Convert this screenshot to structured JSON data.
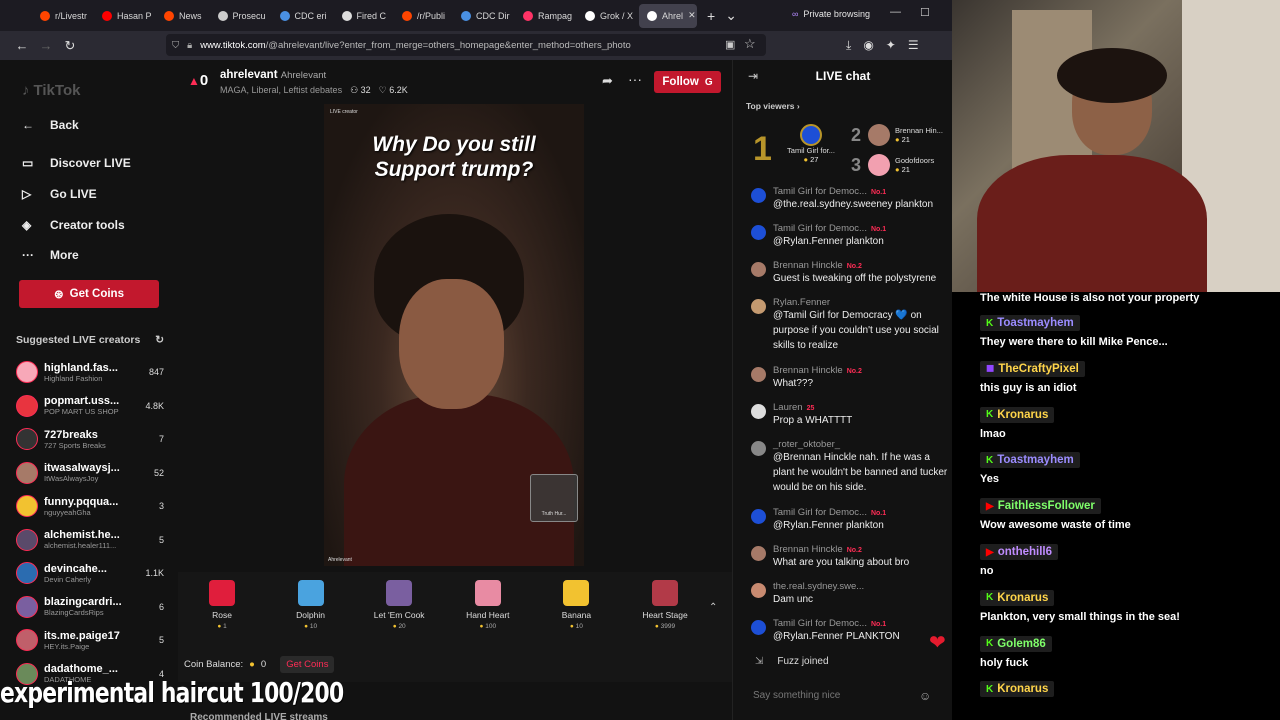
{
  "browser": {
    "tabs": [
      {
        "title": "r/Livestr",
        "color": "#ff4500"
      },
      {
        "title": "Hasan P",
        "color": "#ff0000"
      },
      {
        "title": "News",
        "color": "#ff4500"
      },
      {
        "title": "Prosecu",
        "color": "#cccccc"
      },
      {
        "title": "CDC eri",
        "color": "#4a90e2"
      },
      {
        "title": "Fired C",
        "color": "#dddddd"
      },
      {
        "title": "/r/Publi",
        "color": "#ff4500"
      },
      {
        "title": "CDC Dir",
        "color": "#4a90e2"
      },
      {
        "title": "Rampag",
        "color": "#ff3366"
      },
      {
        "title": "Grok / X",
        "color": "#ffffff"
      },
      {
        "title": "Ahrel",
        "color": "#ffffff"
      }
    ],
    "private_label": "Private browsing",
    "url_host": "www.tiktok.com",
    "url_path": "/@ahrelevant/live?enter_from_merge=others_homepage&enter_method=others_photo"
  },
  "sidebar": {
    "logo": "TikTok",
    "back": "Back",
    "discover": "Discover LIVE",
    "golive": "Go LIVE",
    "creator_tools": "Creator tools",
    "more": "More",
    "get_coins": "Get Coins",
    "suggested_title": "Suggested LIVE creators",
    "creators": [
      {
        "name": "highland.fas...",
        "sub": "Highland Fashion",
        "count": "847",
        "color": "#f7a8b8"
      },
      {
        "name": "popmart.uss...",
        "sub": "POP MART US SHOP",
        "count": "4.8K",
        "color": "#e8343f"
      },
      {
        "name": "727breaks",
        "sub": "727 Sports Breaks",
        "count": "7",
        "color": "#333333"
      },
      {
        "name": "itwasalwaysj...",
        "sub": "ItWasAlwaysJoy",
        "count": "52",
        "color": "#a67a68"
      },
      {
        "name": "funny.pqqua...",
        "sub": "nguyyeahGha",
        "count": "3",
        "color": "#f2c230"
      },
      {
        "name": "alchemist.he...",
        "sub": "alchemist.healer111...",
        "count": "5",
        "color": "#5a4a6a"
      },
      {
        "name": "devincahe...",
        "sub": "Devin Caherly",
        "count": "1.1K",
        "color": "#2b6cb0"
      },
      {
        "name": "blazingcardri...",
        "sub": "BlazingCardsRips",
        "count": "6",
        "color": "#7a5fa0"
      },
      {
        "name": "its.me.paige17",
        "sub": "HEY.its.Paige",
        "count": "5",
        "color": "#c05f6a"
      },
      {
        "name": "dadathome_...",
        "sub": "DADATHOME",
        "count": "4",
        "color": "#6a8a5a"
      }
    ]
  },
  "stream": {
    "viewer_count_badge": "0",
    "handle": "ahrelevant",
    "display_name": "Ahrelevant",
    "tags": "MAGA, Liberal, Leftist debates",
    "viewers": "32",
    "likes": "6.2K",
    "follow": "Follow",
    "caption_line1": "Why Do you still",
    "caption_line2": "Support trump?",
    "badge_text": "Truth Hur...",
    "video_label_top": "LIVE creator",
    "video_label_bottom": "Ahrelevant",
    "gifts": [
      {
        "name": "Rose",
        "price": "1",
        "color": "#e01e3c"
      },
      {
        "name": "Dolphin",
        "price": "10",
        "color": "#4aa3df"
      },
      {
        "name": "Let 'Em Cook",
        "price": "20",
        "color": "#7a5fa0"
      },
      {
        "name": "Hand Heart",
        "price": "100",
        "color": "#e88ba3"
      },
      {
        "name": "Banana",
        "price": "10",
        "color": "#f2c230"
      },
      {
        "name": "Heart Stage",
        "price": "3999",
        "color": "#b23a48"
      }
    ],
    "balance_label": "Coin Balance:",
    "balance_value": "0",
    "get_coins": "Get Coins",
    "recommended": "Recommended LIVE streams"
  },
  "chat": {
    "title": "LIVE chat",
    "top_viewers": "Top viewers",
    "top": [
      {
        "rank": "1",
        "name": "Tamil Girl for...",
        "coins": "27",
        "color": "#1d4fd6"
      },
      {
        "rank": "2",
        "name": "Brennan Hin...",
        "coins": "21",
        "color": "#a67a68"
      },
      {
        "rank": "3",
        "name": "Godofdoors",
        "coins": "21",
        "color": "#f2a0b0"
      }
    ],
    "messages": [
      {
        "user": "Tamil Girl for Democ...",
        "rank": "No.1",
        "text": "@the.real.sydney.sweeney plankton",
        "color": "#1d4fd6"
      },
      {
        "user": "Tamil Girl for Democ...",
        "rank": "No.1",
        "text": "@Rylan.Fenner plankton",
        "color": "#1d4fd6"
      },
      {
        "user": "Brennan Hinckle",
        "rank": "No.2",
        "text": "Guest is tweaking off the polystyrene",
        "color": "#a67a68"
      },
      {
        "user": "Rylan.Fenner",
        "rank": "",
        "text": "@Tamil Girl for Democracy 💙 on purpose if you couldn't use you social skills to realize",
        "color": "#c49a70"
      },
      {
        "user": "Brennan Hinckle",
        "rank": "No.2",
        "text": "What???",
        "color": "#a67a68"
      },
      {
        "user": "Lauren",
        "rank": "25",
        "text": "Prop a WHATTTT",
        "color": "#dddddd"
      },
      {
        "user": "_roter_oktober_",
        "rank": "",
        "text": "@Brennan Hinckle nah. If he was a plant he wouldn't be banned and tucker would be on his side.",
        "color": "#888888"
      },
      {
        "user": "Tamil Girl for Democ...",
        "rank": "No.1",
        "text": "@Rylan.Fenner plankton",
        "color": "#1d4fd6"
      },
      {
        "user": "Brennan Hinckle",
        "rank": "No.2",
        "text": "What are you talking about bro",
        "color": "#a67a68"
      },
      {
        "user": "the.real.sydney.swe...",
        "rank": "",
        "text": "Dam unc",
        "color": "#c88a70"
      },
      {
        "user": "Tamil Girl for Democ...",
        "rank": "No.1",
        "text": "@Rylan.Fenner PLANKTON",
        "color": "#1d4fd6"
      }
    ],
    "joined": "Fuzz joined",
    "placeholder": "Say something nice"
  },
  "overlay": {
    "top_text": "The white House is also not your property",
    "lines": [
      {
        "user": "Toastmayhem",
        "text": "They were there to kill Mike Pence...",
        "color": "#9b8cff",
        "platform": "kick"
      },
      {
        "user": "TheCraftyPixel",
        "text": "this guy is an idiot",
        "color": "#ffd54a",
        "platform": "twitch"
      },
      {
        "user": "Kronarus",
        "text": "lmao",
        "color": "#ffd54a",
        "platform": "kick"
      },
      {
        "user": "Toastmayhem",
        "text": "Yes",
        "color": "#9b8cff",
        "platform": "kick"
      },
      {
        "user": "FaithlessFollower",
        "text": "Wow awesome waste of time",
        "color": "#7fff6a",
        "platform": "youtube"
      },
      {
        "user": "onthehill6",
        "text": "no",
        "color": "#c08cff",
        "platform": "youtube"
      },
      {
        "user": "Kronarus",
        "text": "Plankton, very small things in the sea!",
        "color": "#ffd54a",
        "platform": "kick"
      },
      {
        "user": "Golem86",
        "text": "holy fuck",
        "color": "#7fff6a",
        "platform": "kick"
      },
      {
        "user": "Kronarus",
        "text": "",
        "color": "#ffd54a",
        "platform": "kick"
      }
    ]
  },
  "caption": "experimental haircut 100/200"
}
